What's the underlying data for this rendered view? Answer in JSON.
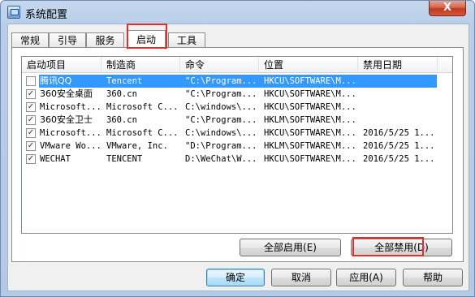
{
  "window": {
    "title": "系统配置",
    "close_label": "X",
    "highlight_color": "#e0302a"
  },
  "tabs": [
    {
      "label": "常规"
    },
    {
      "label": "引导"
    },
    {
      "label": "服务"
    },
    {
      "label": "启动",
      "active": true
    },
    {
      "label": "工具"
    }
  ],
  "startup_list": {
    "columns": [
      "启动项目",
      "制造商",
      "命令",
      "位置",
      "禁用日期"
    ],
    "rows": [
      {
        "checked": false,
        "selected": true,
        "item": "腾讯QQ",
        "maker": "Tencent",
        "command": "\"C:\\Program...",
        "location": "HKCU\\SOFTWARE\\M...",
        "date": ""
      },
      {
        "checked": true,
        "selected": false,
        "item": "360安全桌面",
        "maker": "360.cn",
        "command": "\"C:\\Program...",
        "location": "HKCU\\SOFTWARE\\M...",
        "date": ""
      },
      {
        "checked": true,
        "selected": false,
        "item": "Microsoft...",
        "maker": "Microsoft C...",
        "command": "C:\\windows\\...",
        "location": "HKCU\\SOFTWARE\\M...",
        "date": ""
      },
      {
        "checked": true,
        "selected": false,
        "item": "360安全卫士",
        "maker": "360.cn",
        "command": "\"C:\\Program...",
        "location": "HKLM\\SOFTWARE\\M...",
        "date": ""
      },
      {
        "checked": true,
        "selected": false,
        "item": "Microsoft...",
        "maker": "Microsoft C...",
        "command": "C:\\windows\\...",
        "location": "HKCU\\SOFTWARE\\M...",
        "date": "2016/5/25 1..."
      },
      {
        "checked": true,
        "selected": false,
        "item": "VMware Wo...",
        "maker": "VMware, Inc.",
        "command": "\"D:\\Program...",
        "location": "HKLM\\SOFTWARE\\M...",
        "date": "2016/5/25 1..."
      },
      {
        "checked": true,
        "selected": false,
        "item": "WECHAT",
        "maker": "TENCENT",
        "command": "D:\\WeChat\\W...",
        "location": "HKCU\\SOFTWARE\\M...",
        "date": "2016/5/25 1..."
      }
    ]
  },
  "actions": {
    "enable_all": "全部启用(E)",
    "disable_all": "全部禁用(D)"
  },
  "footer": {
    "ok": "确定",
    "cancel": "取消",
    "apply": "应用(A)",
    "help": "帮助"
  }
}
